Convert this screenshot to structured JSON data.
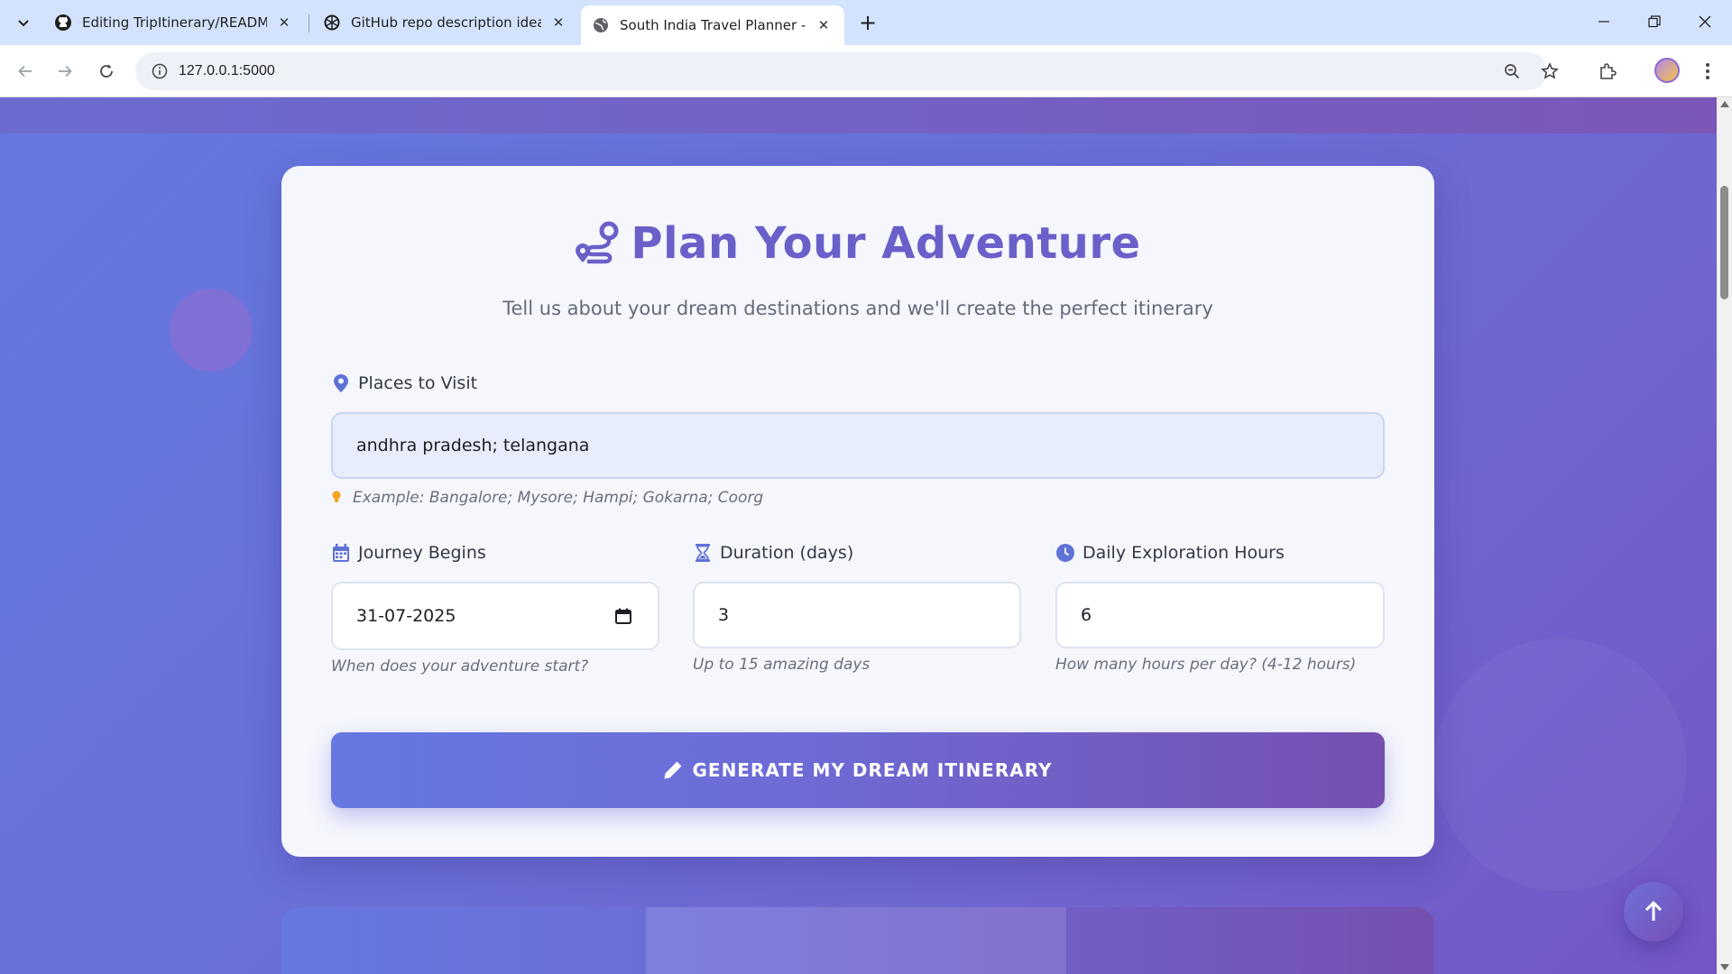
{
  "browser": {
    "tabs": [
      {
        "title": "Editing TripItinerary/README.m",
        "icon": "github-icon"
      },
      {
        "title": "GitHub repo description ideas",
        "icon": "chatgpt-icon"
      },
      {
        "title": "South India Travel Planner - You",
        "icon": "globe-icon",
        "active": true
      }
    ],
    "url": "127.0.0.1:5000"
  },
  "form": {
    "title": "Plan Your Adventure",
    "subtitle": "Tell us about your dream destinations and we'll create the perfect itinerary",
    "places": {
      "label": "Places to Visit",
      "value": "andhra pradesh; telangana",
      "hint": "Example: Bangalore; Mysore; Hampi; Gokarna; Coorg"
    },
    "start_date": {
      "label": "Journey Begins",
      "value": "31-07-2025",
      "helper": "When does your adventure start?"
    },
    "duration": {
      "label": "Duration (days)",
      "value": "3",
      "helper": "Up to 15 amazing days"
    },
    "hours": {
      "label": "Daily Exploration Hours",
      "value": "6",
      "helper": "How many hours per day? (4-12 hours)"
    },
    "submit_label": "GENERATE MY DREAM ITINERARY"
  },
  "colors": {
    "accent": "#6b5fc9",
    "background_start": "#6479e1",
    "background_end": "#7456c4"
  }
}
